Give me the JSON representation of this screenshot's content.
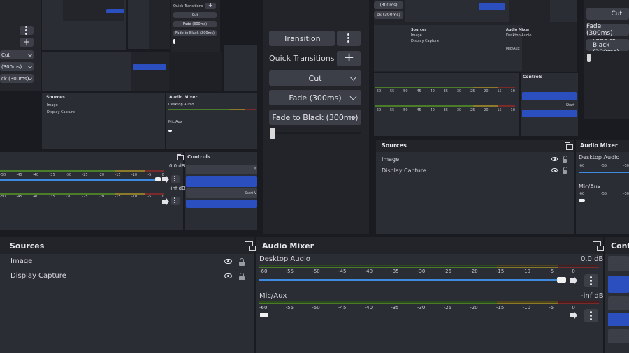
{
  "transitions": {
    "transition_label": "Transition",
    "quick_transitions_label": "Quick Transitions",
    "items": [
      "Cut",
      "Fade (300ms)",
      "Fade to Black (300ms)"
    ]
  },
  "sources": {
    "title": "Sources",
    "items": [
      "Image",
      "Display Capture"
    ]
  },
  "audio_mixer": {
    "title": "Audio Mixer",
    "channels": [
      {
        "name": "Desktop Audio",
        "level": "0.0 dB"
      },
      {
        "name": "Mic/Aux",
        "level": "-inf dB"
      }
    ],
    "ticks": [
      "-60",
      "-55",
      "-50",
      "-45",
      "-40",
      "-35",
      "-30",
      "-25",
      "-20",
      "-15",
      "-10",
      "-5",
      "0"
    ]
  },
  "controls": {
    "title": "Contr",
    "title_small": "Controls",
    "start_label": "Start V",
    "start_label_right": "Start",
    "s_label": "S"
  },
  "mini_top": {
    "quick_transitions": "Quick Transitions",
    "cut": "Cut",
    "fade": "Fade (300ms)",
    "fade_black": "Fade to Black (300ms)",
    "fade_partial": "(300ms)",
    "fade_black_partial": "ck (300ms)",
    "fade_cut": "Fade (300ms)",
    "fade_black_cut": "Fade to Black (300ms)"
  },
  "colors": {
    "accent_blue": "#2b4fbf",
    "slider_blue": "#3d8ae0",
    "panel": "#2b2d34",
    "title_bar": "#22242a"
  }
}
